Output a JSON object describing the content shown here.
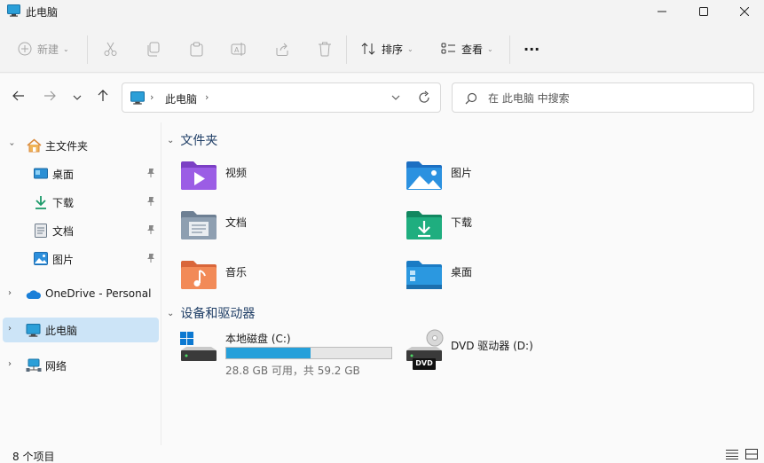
{
  "window": {
    "title": "此电脑"
  },
  "toolbar": {
    "new_label": "新建",
    "sort_label": "排序",
    "view_label": "查看",
    "more_label": "···"
  },
  "address": {
    "crumb": "此电脑",
    "separator": "›"
  },
  "search": {
    "placeholder": "在 此电脑 中搜索"
  },
  "sidebar": {
    "items": [
      {
        "label": "主文件夹",
        "icon": "home-icon"
      },
      {
        "label": "桌面",
        "icon": "desktop-icon",
        "pinned": true
      },
      {
        "label": "下载",
        "icon": "download-icon",
        "pinned": true
      },
      {
        "label": "文档",
        "icon": "document-icon",
        "pinned": true
      },
      {
        "label": "图片",
        "icon": "pictures-icon",
        "pinned": true
      },
      {
        "label": "OneDrive - Personal",
        "icon": "onedrive-icon"
      },
      {
        "label": "此电脑",
        "icon": "this-pc-icon",
        "selected": true
      },
      {
        "label": "网络",
        "icon": "network-icon"
      }
    ]
  },
  "main": {
    "folders_header": "文件夹",
    "folders": [
      {
        "label": "视频",
        "icon": "videos-folder-icon"
      },
      {
        "label": "图片",
        "icon": "pictures-folder-icon"
      },
      {
        "label": "文档",
        "icon": "documents-folder-icon"
      },
      {
        "label": "下载",
        "icon": "downloads-folder-icon"
      },
      {
        "label": "音乐",
        "icon": "music-folder-icon"
      },
      {
        "label": "桌面",
        "icon": "desktop-folder-icon"
      }
    ],
    "drives_header": "设备和驱动器",
    "drives": [
      {
        "label": "本地磁盘 (C:)",
        "free": "28.8 GB 可用，共 59.2 GB",
        "used_fraction": 0.51,
        "icon": "windows-drive-icon"
      },
      {
        "label": "DVD 驱动器 (D:)",
        "badge": "DVD",
        "icon": "dvd-drive-icon"
      }
    ]
  },
  "status": {
    "count": "8 个项目"
  },
  "colors": {
    "accent": "#0078d4",
    "selected_bg": "#cce4f7",
    "usage_bar": "#26a0da"
  }
}
